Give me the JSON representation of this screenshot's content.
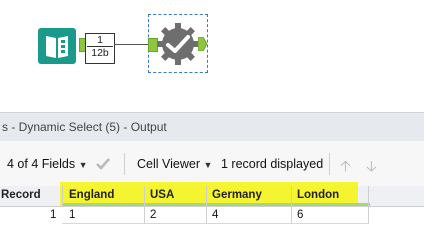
{
  "canvas": {
    "record_badge_count": "1",
    "record_badge_size": "12b"
  },
  "results": {
    "title": "s - Dynamic Select (5) - Output"
  },
  "toolbar": {
    "fields_label": "4 of 4 Fields",
    "viewer_label": "Cell Viewer",
    "status": "1 record displayed"
  },
  "grid": {
    "headers": [
      "Record",
      "England",
      "USA",
      "Germany",
      "London"
    ],
    "rows": [
      [
        "1",
        "1",
        "2",
        "4",
        "6"
      ]
    ]
  },
  "colors": {
    "highlight": "#f4f41c",
    "input_tool": "#1a9a8a",
    "anchor": "#8ec63f"
  }
}
